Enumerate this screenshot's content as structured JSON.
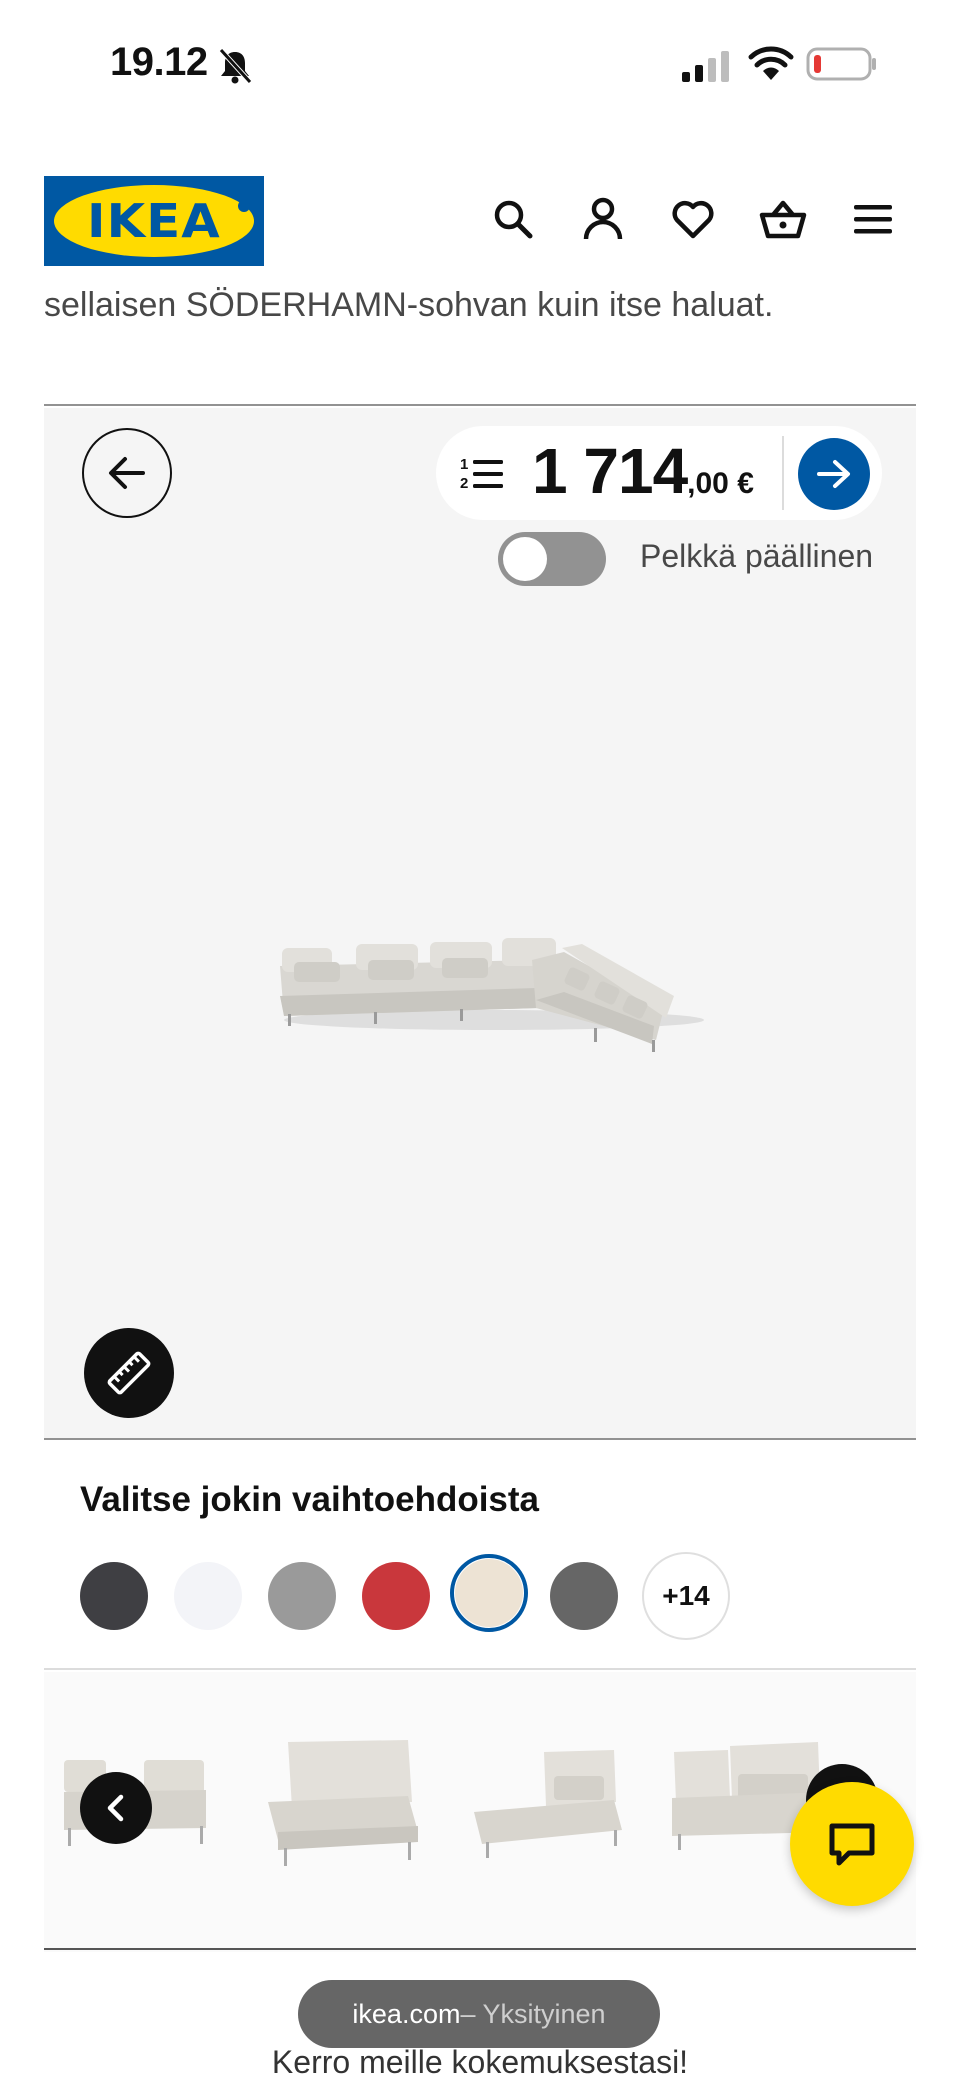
{
  "status_bar": {
    "time": "19.12"
  },
  "header": {
    "logo_text": "IKEA",
    "icons": [
      "search-icon",
      "account-icon",
      "heart-icon",
      "basket-icon",
      "menu-icon"
    ]
  },
  "intro": {
    "cut_text": "sellaisen SÖDERHAMN-sohvan kuin itse haluat."
  },
  "viewer": {
    "price_integer": "1 714",
    "price_decimal": ",00 €",
    "toggle_label": "Pelkkä päällinen",
    "toggle_on": false
  },
  "options": {
    "title": "Valitse jokin vaihtoehdoista",
    "swatches": [
      {
        "name": "swatch-dark-grey",
        "color": "#3f3f43"
      },
      {
        "name": "swatch-white",
        "color": "#f3f4f8"
      },
      {
        "name": "swatch-grey",
        "color": "#9a9a9a"
      },
      {
        "name": "swatch-red",
        "color": "#c9373c"
      },
      {
        "name": "swatch-beige",
        "color": "#ede3d4",
        "selected": true
      },
      {
        "name": "swatch-medium-grey",
        "color": "#666666"
      }
    ],
    "more_label": "+14"
  },
  "footer": {
    "url_domain": "ikea.com",
    "url_private": " – Yksityinen",
    "feedback": "Kerro meille kokemuksestasi!"
  },
  "colors": {
    "ikea_blue": "#0058a3",
    "ikea_yellow": "#ffdb00"
  }
}
